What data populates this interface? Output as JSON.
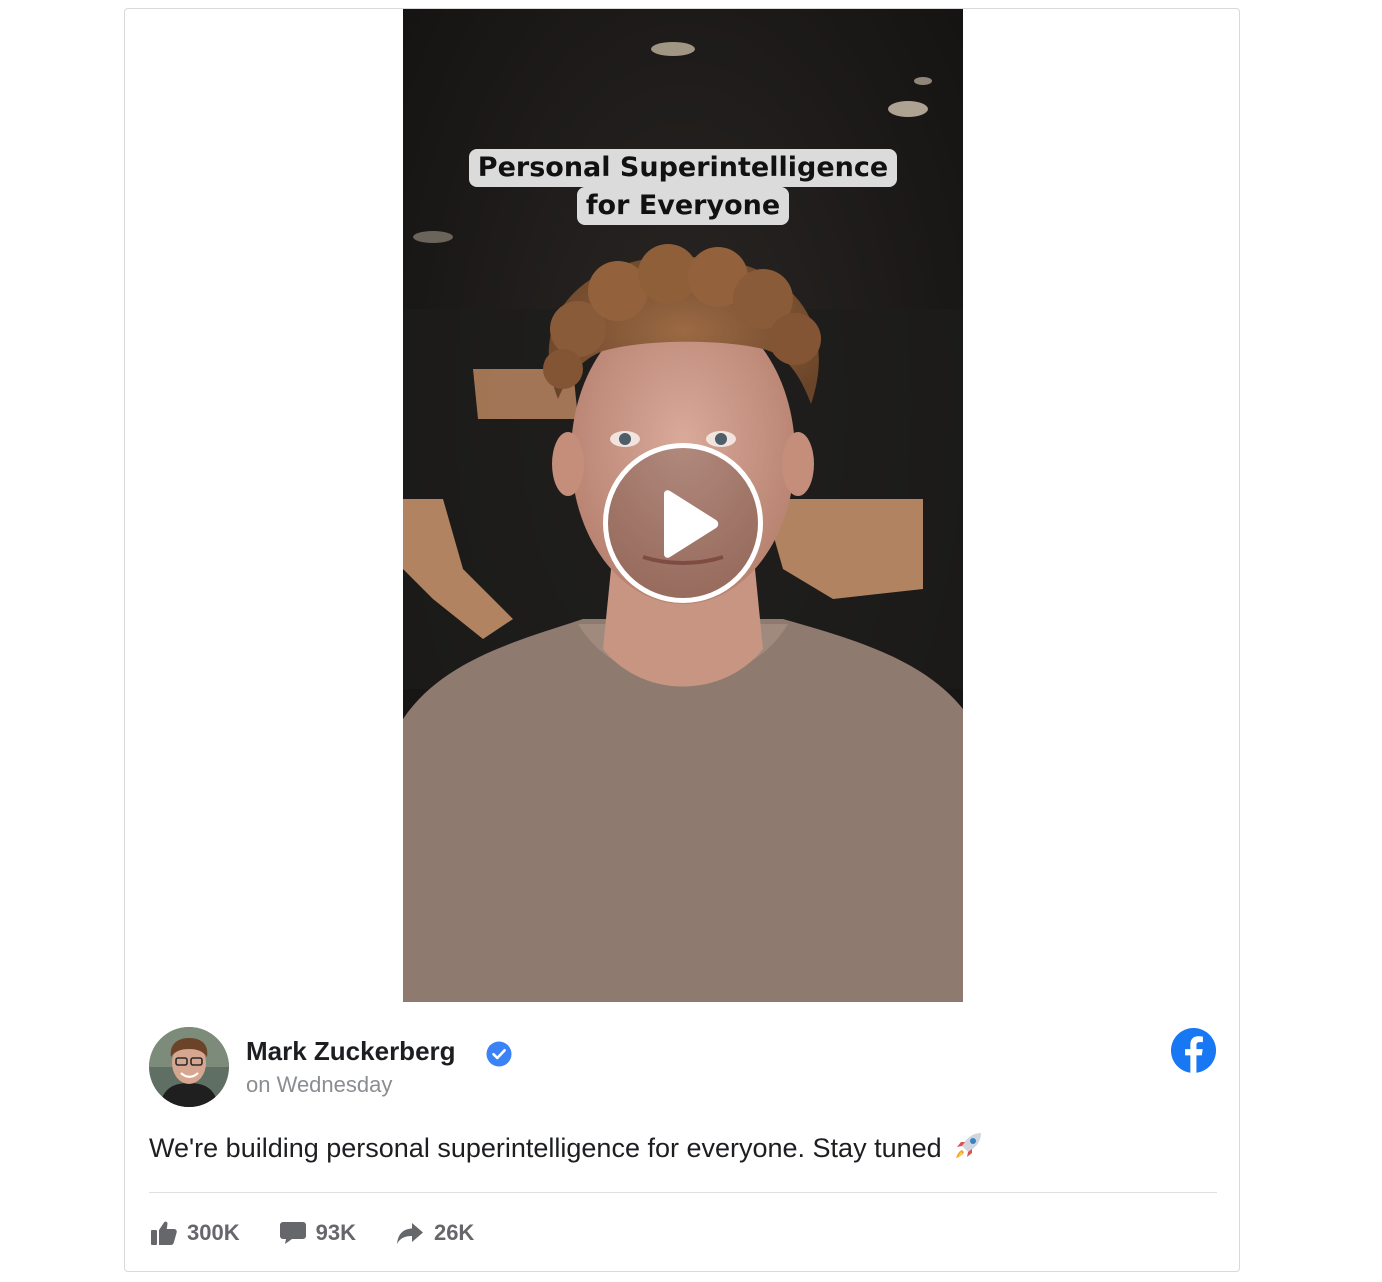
{
  "video": {
    "caption_line1": "Personal Superintelligence",
    "caption_line2": "for Everyone",
    "play_icon": "play-icon"
  },
  "author": {
    "name": "Mark Zuckerberg",
    "time": "on Wednesday",
    "verified_icon": "verified-badge-icon"
  },
  "post": {
    "text": "We're building personal superintelligence for everyone. Stay tuned",
    "emoji_icon": "rocket-icon"
  },
  "stats": {
    "likes": "300K",
    "comments": "93K",
    "shares": "26K"
  },
  "colors": {
    "facebook_blue": "#1877f2",
    "verified_blue": "#3b82f6",
    "text_primary": "#1c1e21",
    "text_secondary": "#8a8d91",
    "stat_gray": "#65676b"
  }
}
